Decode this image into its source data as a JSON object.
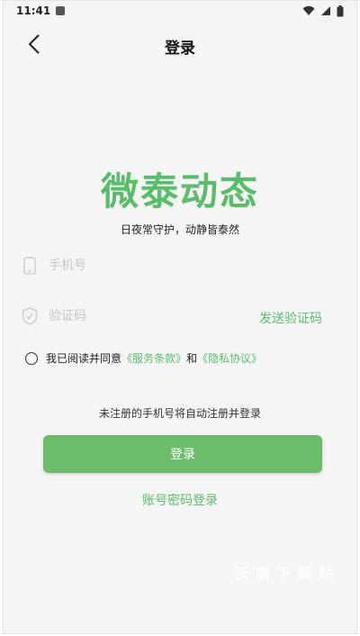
{
  "status_bar": {
    "time": "11:41",
    "icons": [
      "notification-icon",
      "wifi-icon",
      "signal-icon",
      "battery-icon"
    ]
  },
  "nav": {
    "back_icon": "chevron-left-icon",
    "title": "登录"
  },
  "brand": {
    "app_name": "微泰动态",
    "slogan": "日夜常守护，动静皆泰然"
  },
  "form": {
    "phone": {
      "icon": "phone-icon",
      "value": "",
      "placeholder": "手机号"
    },
    "code": {
      "icon": "shield-icon",
      "value": "",
      "placeholder": "验证码"
    },
    "send_code_label": "发送验证码"
  },
  "agreement": {
    "checked": false,
    "prefix": "我已阅读并同意",
    "terms_label": "《服务条款》",
    "conjunction": "和",
    "privacy_label": "《隐私协议》"
  },
  "notice": "未注册的手机号将自动注册并登录",
  "login_button_label": "登录",
  "password_login_label": "账号密码登录",
  "watermark": "沃 盾 下 载 站",
  "colors": {
    "accent": "#5bbd6b",
    "button": "#6cbc6b",
    "background": "#f5f5f5"
  }
}
